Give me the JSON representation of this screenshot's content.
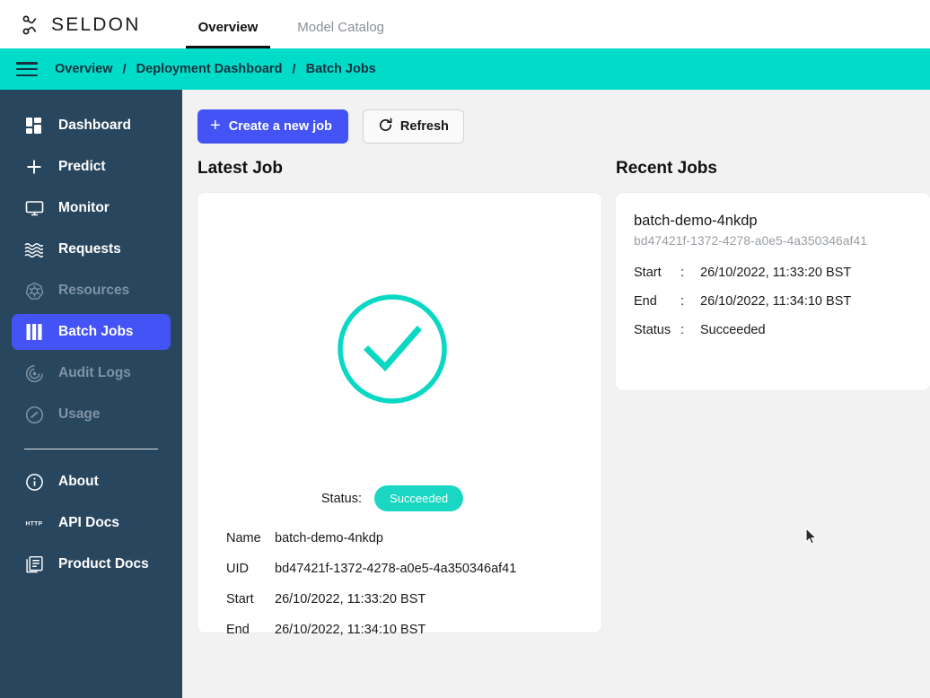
{
  "brand": {
    "name": "SELDON",
    "logo_icon": "seldon-knot-logo"
  },
  "topnav": {
    "items": [
      {
        "label": "Overview",
        "active": true
      },
      {
        "label": "Model Catalog",
        "active": false
      }
    ]
  },
  "breadcrumb": {
    "menu_icon": "hamburger-icon",
    "separator": "/",
    "items": [
      {
        "label": "Overview"
      },
      {
        "label": "Deployment Dashboard"
      },
      {
        "label": "Batch Jobs"
      }
    ]
  },
  "sidebar": {
    "items": [
      {
        "label": "Dashboard",
        "icon": "dashboard-grid-icon",
        "state": "normal"
      },
      {
        "label": "Predict",
        "icon": "plus-icon",
        "state": "normal"
      },
      {
        "label": "Monitor",
        "icon": "monitor-screen-icon",
        "state": "normal"
      },
      {
        "label": "Requests",
        "icon": "waves-icon",
        "state": "normal"
      },
      {
        "label": "Resources",
        "icon": "kubernetes-helm-icon",
        "state": "dim"
      },
      {
        "label": "Batch Jobs",
        "icon": "bars-icon",
        "state": "active"
      },
      {
        "label": "Audit Logs",
        "icon": "spiral-target-icon",
        "state": "dim"
      },
      {
        "label": "Usage",
        "icon": "gauge-icon",
        "state": "dim"
      }
    ],
    "footer_items": [
      {
        "label": "About",
        "icon": "info-circle-icon"
      },
      {
        "label": "API Docs",
        "icon": "http-icon"
      },
      {
        "label": "Product Docs",
        "icon": "documents-icon"
      }
    ]
  },
  "toolbar": {
    "create_label": "Create a new job",
    "create_icon": "plus-icon",
    "refresh_label": "Refresh",
    "refresh_icon": "refresh-icon"
  },
  "latest_job": {
    "section_title": "Latest Job",
    "status_icon": "check-circle-icon",
    "status_label": "Status:",
    "status_value": "Succeeded",
    "fields": [
      {
        "key": "Name",
        "value": "batch-demo-4nkdp"
      },
      {
        "key": "UID",
        "value": "bd47421f-1372-4278-a0e5-4a350346af41"
      },
      {
        "key": "Start",
        "value": "26/10/2022, 11:33:20 BST"
      },
      {
        "key": "End",
        "value": "26/10/2022, 11:34:10 BST"
      }
    ]
  },
  "recent_jobs": {
    "section_title": "Recent Jobs",
    "jobs": [
      {
        "name": "batch-demo-4nkdp",
        "uid": "bd47421f-1372-4278-a0e5-4a350346af41",
        "rows": [
          {
            "key": "Start",
            "colon": ":",
            "value": "26/10/2022, 11:33:20 BST"
          },
          {
            "key": "End",
            "colon": ":",
            "value": "26/10/2022, 11:34:10 BST"
          },
          {
            "key": "Status",
            "colon": ":",
            "value": "Succeeded"
          }
        ]
      }
    ]
  },
  "colors": {
    "accent_teal": "#00dcc8",
    "status_teal": "#19d7c2",
    "primary_blue": "#4353f5",
    "sidebar_navy": "#28465e",
    "page_bg": "#f2f2f2"
  }
}
